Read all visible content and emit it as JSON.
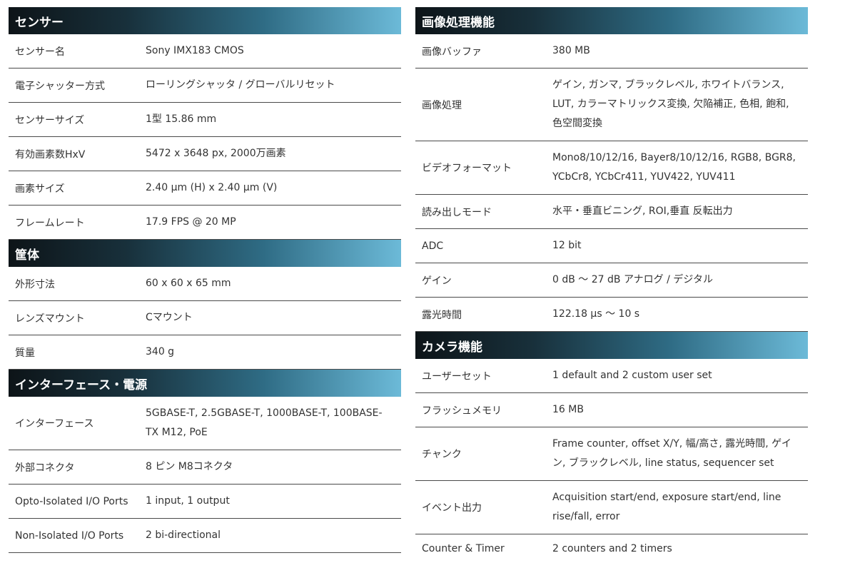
{
  "left": {
    "sensor": {
      "title": "センサー",
      "rows": [
        {
          "k": "センサー名",
          "v": "Sony IMX183 CMOS"
        },
        {
          "k": "電子シャッター方式",
          "v": "ローリングシャッタ / グローバルリセット"
        },
        {
          "k": "センサーサイズ",
          "v": "1型 15.86 mm"
        },
        {
          "k": "有効画素数HxV",
          "v": "5472 x 3648 px, 2000万画素"
        },
        {
          "k": "画素サイズ",
          "v": "2.40 μm (H) x 2.40 μm (V)"
        },
        {
          "k": "フレームレート",
          "v": "17.9 FPS @ 20 MP"
        }
      ]
    },
    "housing": {
      "title": "筐体",
      "rows": [
        {
          "k": "外形寸法",
          "v": "60 x 60 x 65 mm"
        },
        {
          "k": "レンズマウント",
          "v": "Cマウント"
        },
        {
          "k": "質量",
          "v": "340 g"
        }
      ]
    },
    "interface": {
      "title": "インターフェース・電源",
      "rows": [
        {
          "k": "インターフェース",
          "v": "5GBASE-T, 2.5GBASE-T, 1000BASE-T, 100BASE-TX M12, PoE"
        },
        {
          "k": "外部コネクタ",
          "v": "8 ピン M8コネクタ"
        },
        {
          "k": "Opto-Isolated I/O Ports",
          "v": "1 input, 1 output"
        },
        {
          "k": "Non-Isolated I/O Ports",
          "v": "2 bi-directional"
        }
      ]
    }
  },
  "right": {
    "processing": {
      "title": "画像処理機能",
      "rows": [
        {
          "k": "画像バッファ",
          "v": "380 MB"
        },
        {
          "k": "画像処理",
          "v": "ゲイン, ガンマ, ブラックレベル, ホワイトバランス, LUT, カラーマトリックス変換, 欠陥補正, 色相, 飽和, 色空間変換"
        },
        {
          "k": "ビデオフォーマット",
          "v": "Mono8/10/12/16, Bayer8/10/12/16, RGB8, BGR8, YCbCr8, YCbCr411, YUV422, YUV411"
        },
        {
          "k": "読み出しモード",
          "v": "水平・垂直ビニング, ROI,垂直 反転出力"
        },
        {
          "k": "ADC",
          "v": "12 bit"
        },
        {
          "k": "ゲイン",
          "v": "0 dB ～ 27 dB アナログ / デジタル"
        },
        {
          "k": "露光時間",
          "v": "122.18 μs ～ 10 s"
        }
      ]
    },
    "camera": {
      "title": "カメラ機能",
      "rows": [
        {
          "k": "ユーザーセット",
          "v": "1 default and 2 custom user set"
        },
        {
          "k": "フラッシュメモリ",
          "v": "16 MB"
        },
        {
          "k": "チャンク",
          "v": "Frame counter, offset X/Y, 幅/高さ, 露光時間, ゲイン, ブラックレベル, line status, sequencer set"
        },
        {
          "k": "イベント出力",
          "v": "Acquisition start/end, exposure start/end, line rise/fall, error"
        },
        {
          "k": "Counter & Timer",
          "v": "2 counters and 2 timers"
        }
      ]
    }
  }
}
